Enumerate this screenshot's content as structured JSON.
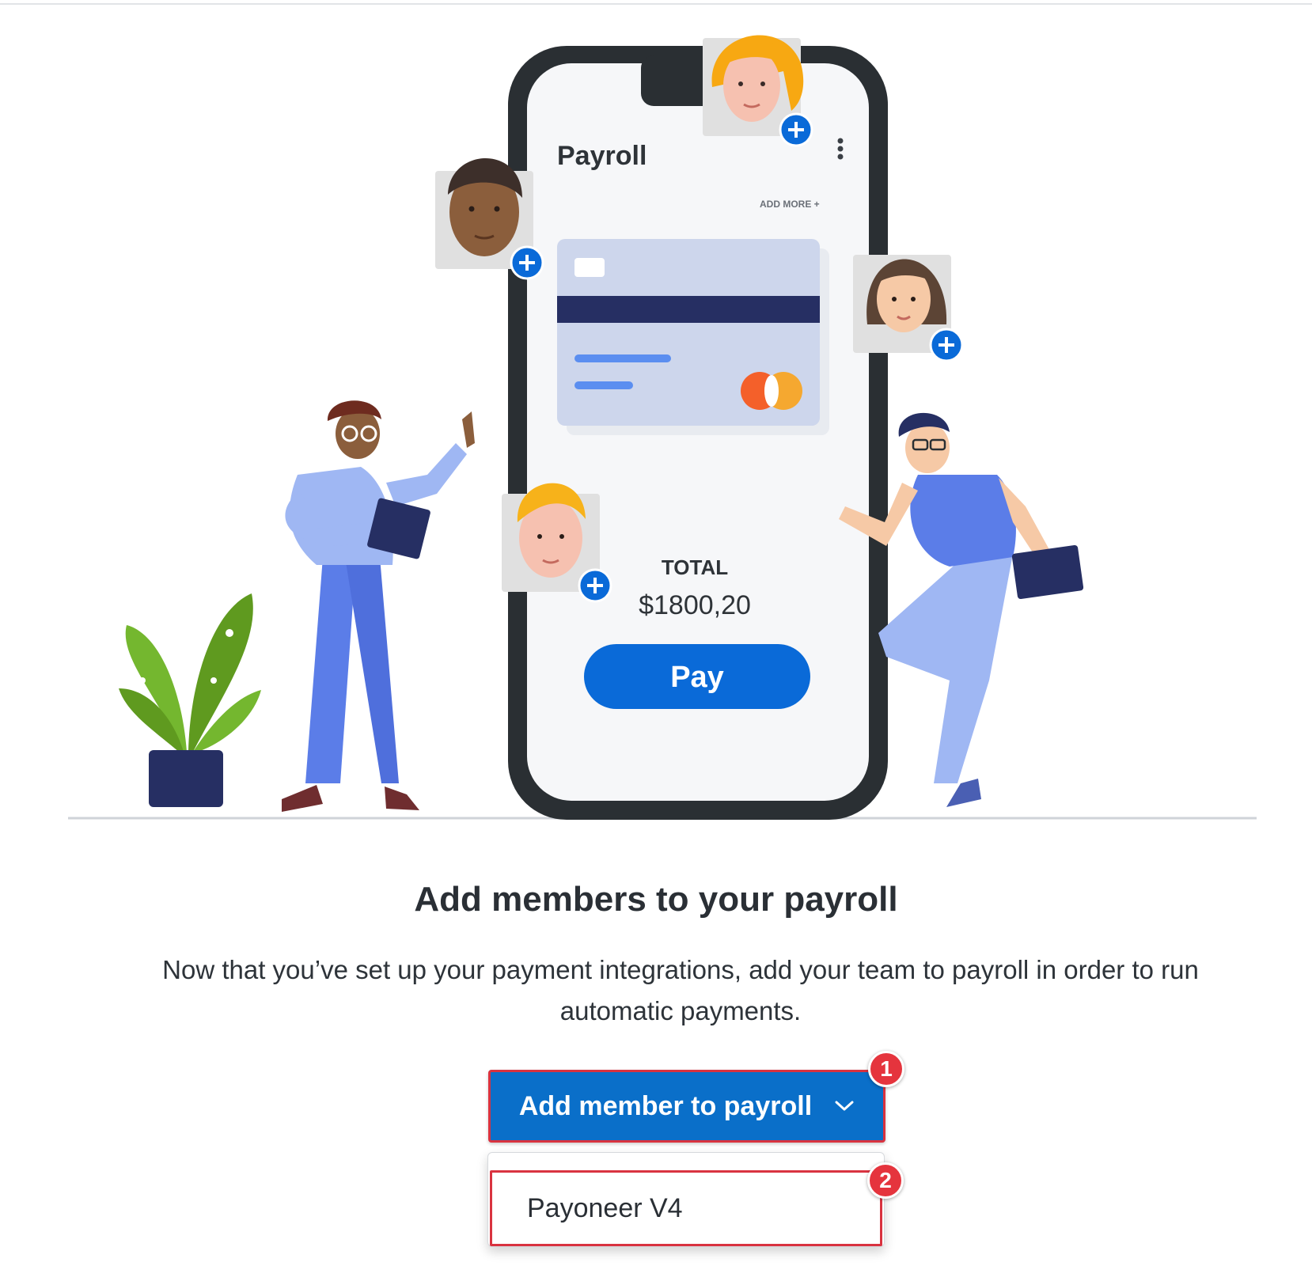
{
  "illustration": {
    "phone_title": "Payroll",
    "add_more_label": "ADD MORE +",
    "total_label": "TOTAL",
    "total_amount": "$1800,20",
    "pay_button_label": "Pay"
  },
  "main": {
    "heading": "Add members to your payroll",
    "description": "Now that you’ve set up your payment integrations, add your team to payroll in order to run automatic payments."
  },
  "add_member_button": {
    "label": "Add member to payroll",
    "icon": "chevron-down-icon"
  },
  "dropdown": {
    "items": [
      {
        "label": "Payoneer V4"
      }
    ]
  },
  "annotations": {
    "badge_1": "1",
    "badge_2": "2"
  },
  "colors": {
    "primary_blue": "#0a6fc9",
    "annotation_red": "#e5343d",
    "phone_frame": "#2a2f33",
    "card_bg": "#cdd6ec",
    "card_stripe": "#262f63"
  }
}
